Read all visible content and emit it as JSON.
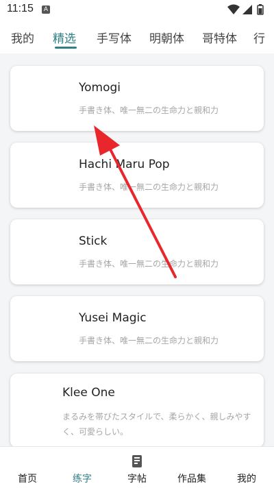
{
  "status_bar": {
    "time": "11:15",
    "app_icon_letter": "A",
    "icons": [
      "wifi-icon",
      "signal-icon",
      "battery-icon"
    ]
  },
  "tabs": [
    {
      "label": "我的"
    },
    {
      "label": "精选"
    },
    {
      "label": "手写体"
    },
    {
      "label": "明朝体"
    },
    {
      "label": "哥特体"
    },
    {
      "label": "行"
    }
  ],
  "active_tab": "精选",
  "cards": [
    {
      "title": "Yomogi",
      "desc": "手書き体、唯一無二の生命力と親和力"
    },
    {
      "title": "Hachi Maru Pop",
      "desc": "手書き体、唯一無二の生命力と親和力"
    },
    {
      "title": "Stick",
      "desc": "手書き体、唯一無二の生命力と親和力"
    },
    {
      "title": "Yusei Magic",
      "desc": "手書き体、唯一無二の生命力と親和力"
    },
    {
      "title": "Klee One",
      "desc": "まるみを帯びたスタイルで、柔らかく、親しみやすく、可愛らしい。"
    }
  ],
  "bottom_nav": [
    {
      "label": "首页"
    },
    {
      "label": "练字"
    },
    {
      "label": "字帖",
      "icon": "copybook-icon"
    },
    {
      "label": "作品集"
    },
    {
      "label": "我的"
    }
  ],
  "active_nav": "练字",
  "colors": {
    "accent": "#2f7f86",
    "annotation_arrow": "#e8262b",
    "card_background": "#ffffff",
    "page_background": "#f4f5f7",
    "secondary_text": "#a6a6a6"
  }
}
